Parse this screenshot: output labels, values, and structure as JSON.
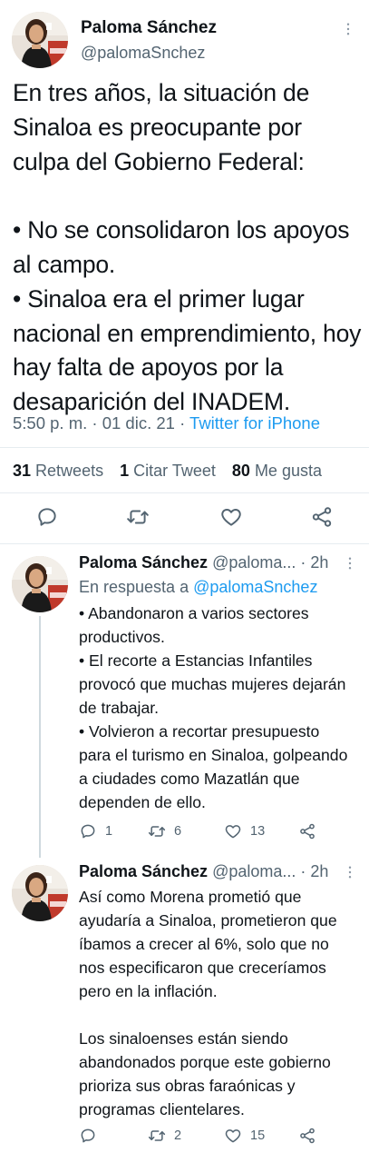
{
  "main_tweet": {
    "name": "Paloma Sánchez",
    "handle": "@palomaSnchez",
    "text": "En tres años, la situación de Sinaloa es preocupante por culpa del Gobierno Federal:\n\n• No se consolidaron los apoyos al campo.\n• Sinaloa era el primer lugar nacional en emprendimiento, hoy hay falta de apoyos por la desaparición del INADEM.",
    "time": "5:50 p. m. · 01 dic. 21 · ",
    "source": "Twitter for iPhone",
    "retweets_count": "31",
    "retweets_label": "Retweets",
    "quotes_count": "1",
    "quotes_label": "Citar Tweet",
    "likes_count": "80",
    "likes_label": "Me gusta"
  },
  "replies": [
    {
      "name": "Paloma Sánchez",
      "handle_time": "@paloma... · 2h",
      "in_reply_prefix": "En respuesta a ",
      "in_reply_mention": "@palomaSnchez",
      "text": "• Abandonaron a varios sectores productivos.\n• El recorte a Estancias Infantiles provocó que muchas mujeres dejarán de trabajar.\n• Volvieron a recortar presupuesto para el turismo en Sinaloa, golpeando a ciudades como Mazatlán que dependen de ello.",
      "replies_count": "1",
      "retweets_count": "6",
      "likes_count": "13"
    },
    {
      "name": "Paloma Sánchez",
      "handle_time": "@paloma... · 2h",
      "text": "Así como Morena prometió que ayudaría a Sinaloa, prometieron que íbamos a crecer al 6%, solo que no nos especificaron que creceríamos pero en la inflación.\n\nLos sinaloenses están siendo abandonados porque este gobierno prioriza sus obras faraónicas y programas clientelares.",
      "replies_count": "",
      "retweets_count": "2",
      "likes_count": "15"
    }
  ],
  "icons": {
    "reply": "reply-icon",
    "retweet": "retweet-icon",
    "like": "heart-icon",
    "share": "share-icon",
    "more": "more-icon"
  },
  "colors": {
    "link": "#1d9bf0",
    "secondary": "#536471",
    "text": "#0f1419"
  }
}
